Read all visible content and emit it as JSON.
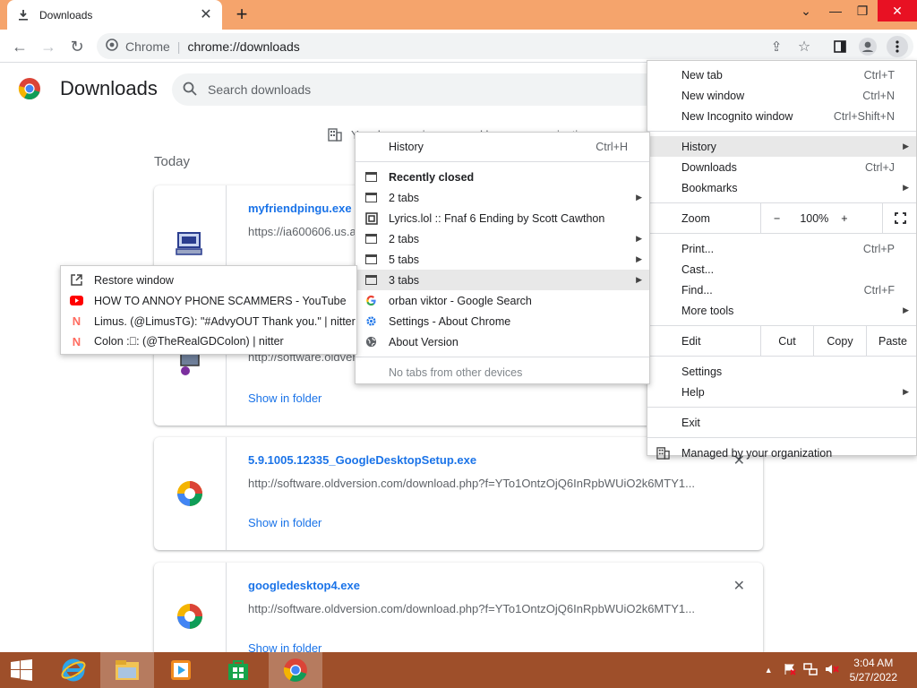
{
  "tab": {
    "title": "Downloads"
  },
  "toolbar": {
    "site_label": "Chrome",
    "separator": "|",
    "url": "chrome://downloads"
  },
  "page": {
    "title": "Downloads",
    "search_placeholder": "Search downloads",
    "managed_text": "Your browser is managed by your organization",
    "date_header": "Today"
  },
  "downloads": [
    {
      "name": "myfriendpingu.exe",
      "url": "https://ia600606.us.archive.org/",
      "action": "Show in folder"
    },
    {
      "name": "",
      "url": "http://software.oldversion.com/",
      "action": "Show in folder"
    },
    {
      "name": "5.9.1005.12335_GoogleDesktopSetup.exe",
      "url": "http://software.oldversion.com/download.php?f=YTo1OntzOjQ6InRpbWUiO2k6MTY1...",
      "action": "Show in folder"
    },
    {
      "name": "googledesktop4.exe",
      "url": "http://software.oldversion.com/download.php?f=YTo1OntzOjQ6InRpbWUiO2k6MTY1...",
      "action": "Show in folder"
    }
  ],
  "main_menu": {
    "new_tab": "New tab",
    "new_tab_sc": "Ctrl+T",
    "new_window": "New window",
    "new_window_sc": "Ctrl+N",
    "incognito": "New Incognito window",
    "incognito_sc": "Ctrl+Shift+N",
    "history": "History",
    "downloads": "Downloads",
    "downloads_sc": "Ctrl+J",
    "bookmarks": "Bookmarks",
    "zoom": "Zoom",
    "zoom_minus": "−",
    "zoom_value": "100%",
    "zoom_plus": "+",
    "print": "Print...",
    "print_sc": "Ctrl+P",
    "cast": "Cast...",
    "find": "Find...",
    "find_sc": "Ctrl+F",
    "more_tools": "More tools",
    "edit": "Edit",
    "cut": "Cut",
    "copy": "Copy",
    "paste": "Paste",
    "settings": "Settings",
    "help": "Help",
    "exit": "Exit",
    "managed": "Managed by your organization"
  },
  "history_menu": {
    "history": "History",
    "history_sc": "Ctrl+H",
    "recently_closed": "Recently closed",
    "items": [
      "2 tabs",
      "Lyrics.lol :: Fnaf 6 Ending by Scott Cawthon",
      "2 tabs",
      "5 tabs",
      "3 tabs",
      "orban viktor - Google Search",
      "Settings - About Chrome",
      "About Version"
    ],
    "no_tabs": "No tabs from other devices"
  },
  "window_menu": {
    "restore": "Restore window",
    "items": [
      "HOW TO ANNOY PHONE SCAMMERS - YouTube",
      "Limus. (@LimusTG): \"#AdvyOUT Thank you.\" | nitter",
      "Colon :⎕: (@TheRealGDColon) | nitter"
    ]
  },
  "taskbar": {
    "time": "3:04 AM",
    "date": "5/27/2022"
  },
  "colors": {
    "accent": "#1a73e8",
    "titlebar": "#f5a46c",
    "taskbar": "#9e4f2a"
  }
}
